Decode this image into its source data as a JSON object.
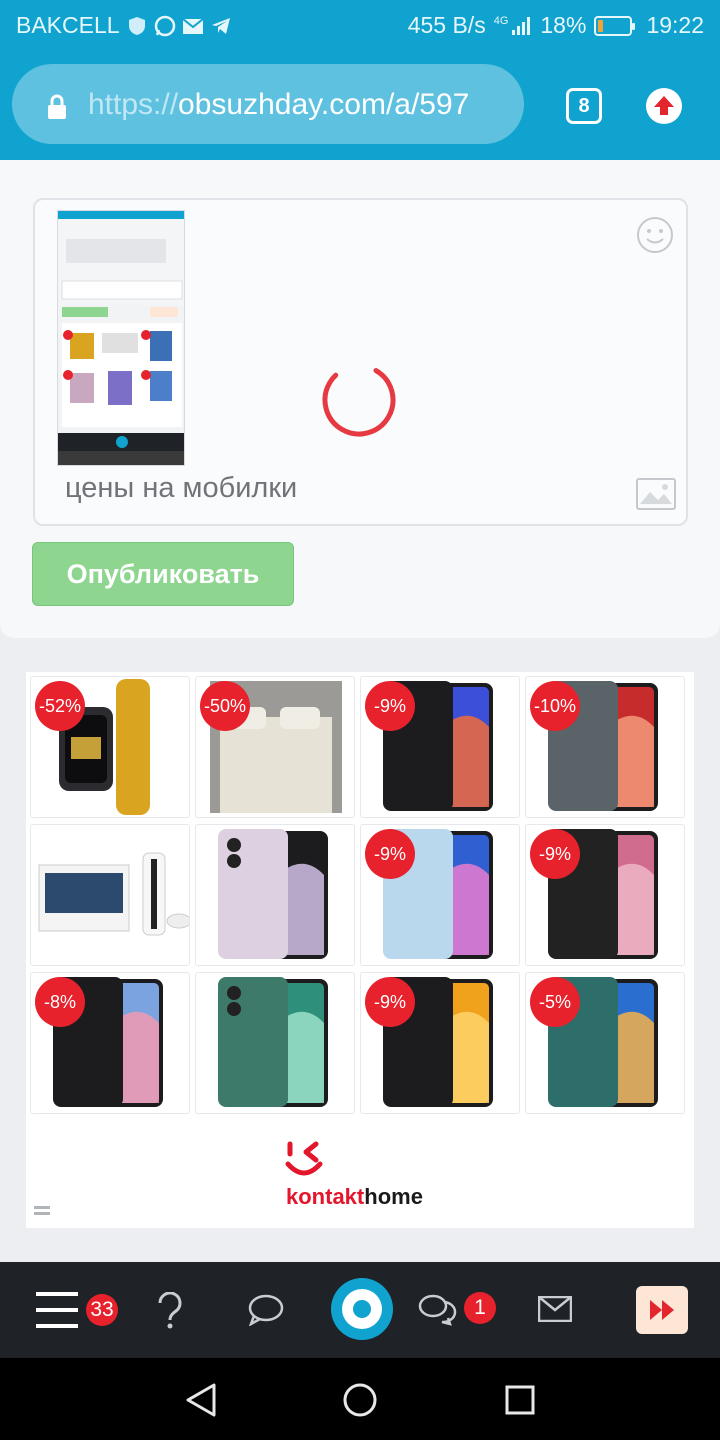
{
  "status_bar": {
    "carrier": "BAKCELL",
    "net_speed": "455 B/s",
    "network": "4G",
    "battery": "18%",
    "battery_level": 0.18,
    "time": "19:22"
  },
  "browser": {
    "url_protocol": "https://",
    "url_host": "obsuzhday.com/a/597",
    "tab_count": "8"
  },
  "comment_form": {
    "text": "цены на мобилки",
    "publish_label": "Опубликовать"
  },
  "ad": {
    "products": [
      {
        "discount": "-52%",
        "kind": "watch"
      },
      {
        "discount": "-50%",
        "kind": "bedding"
      },
      {
        "discount": "-9%",
        "kind": "phone-blue"
      },
      {
        "discount": "-10%",
        "kind": "phone-red"
      },
      {
        "discount": "",
        "kind": "console"
      },
      {
        "discount": "",
        "kind": "phone-lilac"
      },
      {
        "discount": "-9%",
        "kind": "phone-lightblue"
      },
      {
        "discount": "-9%",
        "kind": "phone-black"
      },
      {
        "discount": "-8%",
        "kind": "phone-dark"
      },
      {
        "discount": "",
        "kind": "phone-green"
      },
      {
        "discount": "-9%",
        "kind": "phone-yellow"
      },
      {
        "discount": "-5%",
        "kind": "phone-teal"
      }
    ],
    "brand_k": "kontakt",
    "brand_home": "home"
  },
  "toolbar": {
    "menu_count": "33",
    "messages_count": "1"
  },
  "colors": {
    "accent": "#10a3cf",
    "publish": "#8ed58f",
    "discount": "#e7222c"
  }
}
